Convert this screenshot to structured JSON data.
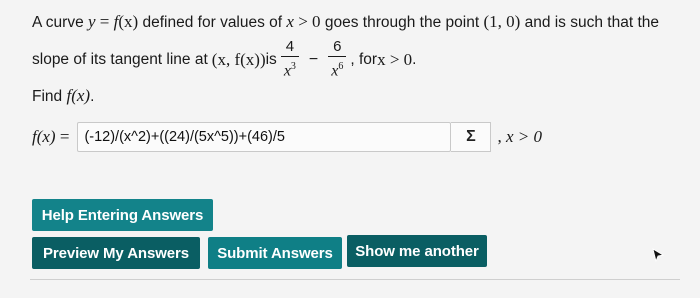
{
  "problem": {
    "l1_a": "A curve ",
    "l1_math_y": "y",
    "l1_math_eq": " = ",
    "l1_math_f": "f",
    "l1_math_x1": "(x)",
    "l1_b": " defined for values of ",
    "l1_math_x2": "x",
    "l1_math_gt0": " > 0",
    "l1_c": " goes through the point ",
    "l1_point": "(1, 0)",
    "l1_d": " and is such that the",
    "l2_a": "slope of its tangent line at ",
    "l2_pt": "(x, f(x))",
    "l2_b": " is",
    "frac1_num": "4",
    "frac1_den_base": "x",
    "frac1_den_exp": "3",
    "minus": "−",
    "frac2_num": "6",
    "frac2_den_base": "x",
    "frac2_den_exp": "6",
    "l2_c": ", for ",
    "l2_cond": "x > 0",
    "l2_end": "."
  },
  "find": {
    "text": "Find ",
    "target": "f(x)",
    "end": "."
  },
  "answer": {
    "label_f": "f(x)",
    "label_eq": " = ",
    "value": "(-12)/(x^2)+((24)/(5x^5))+(46)/5",
    "sigma": "Σ",
    "domain_sep": ", ",
    "domain": "x > 0"
  },
  "buttons": {
    "help": "Help Entering Answers",
    "preview": "Preview My Answers",
    "submit": "Submit Answers",
    "another": "Show me another"
  },
  "colors": {
    "teal": "#0f7f86",
    "dark_teal": "#0a5e63"
  },
  "icons": {
    "cursor": "mouse-pointer-icon"
  }
}
